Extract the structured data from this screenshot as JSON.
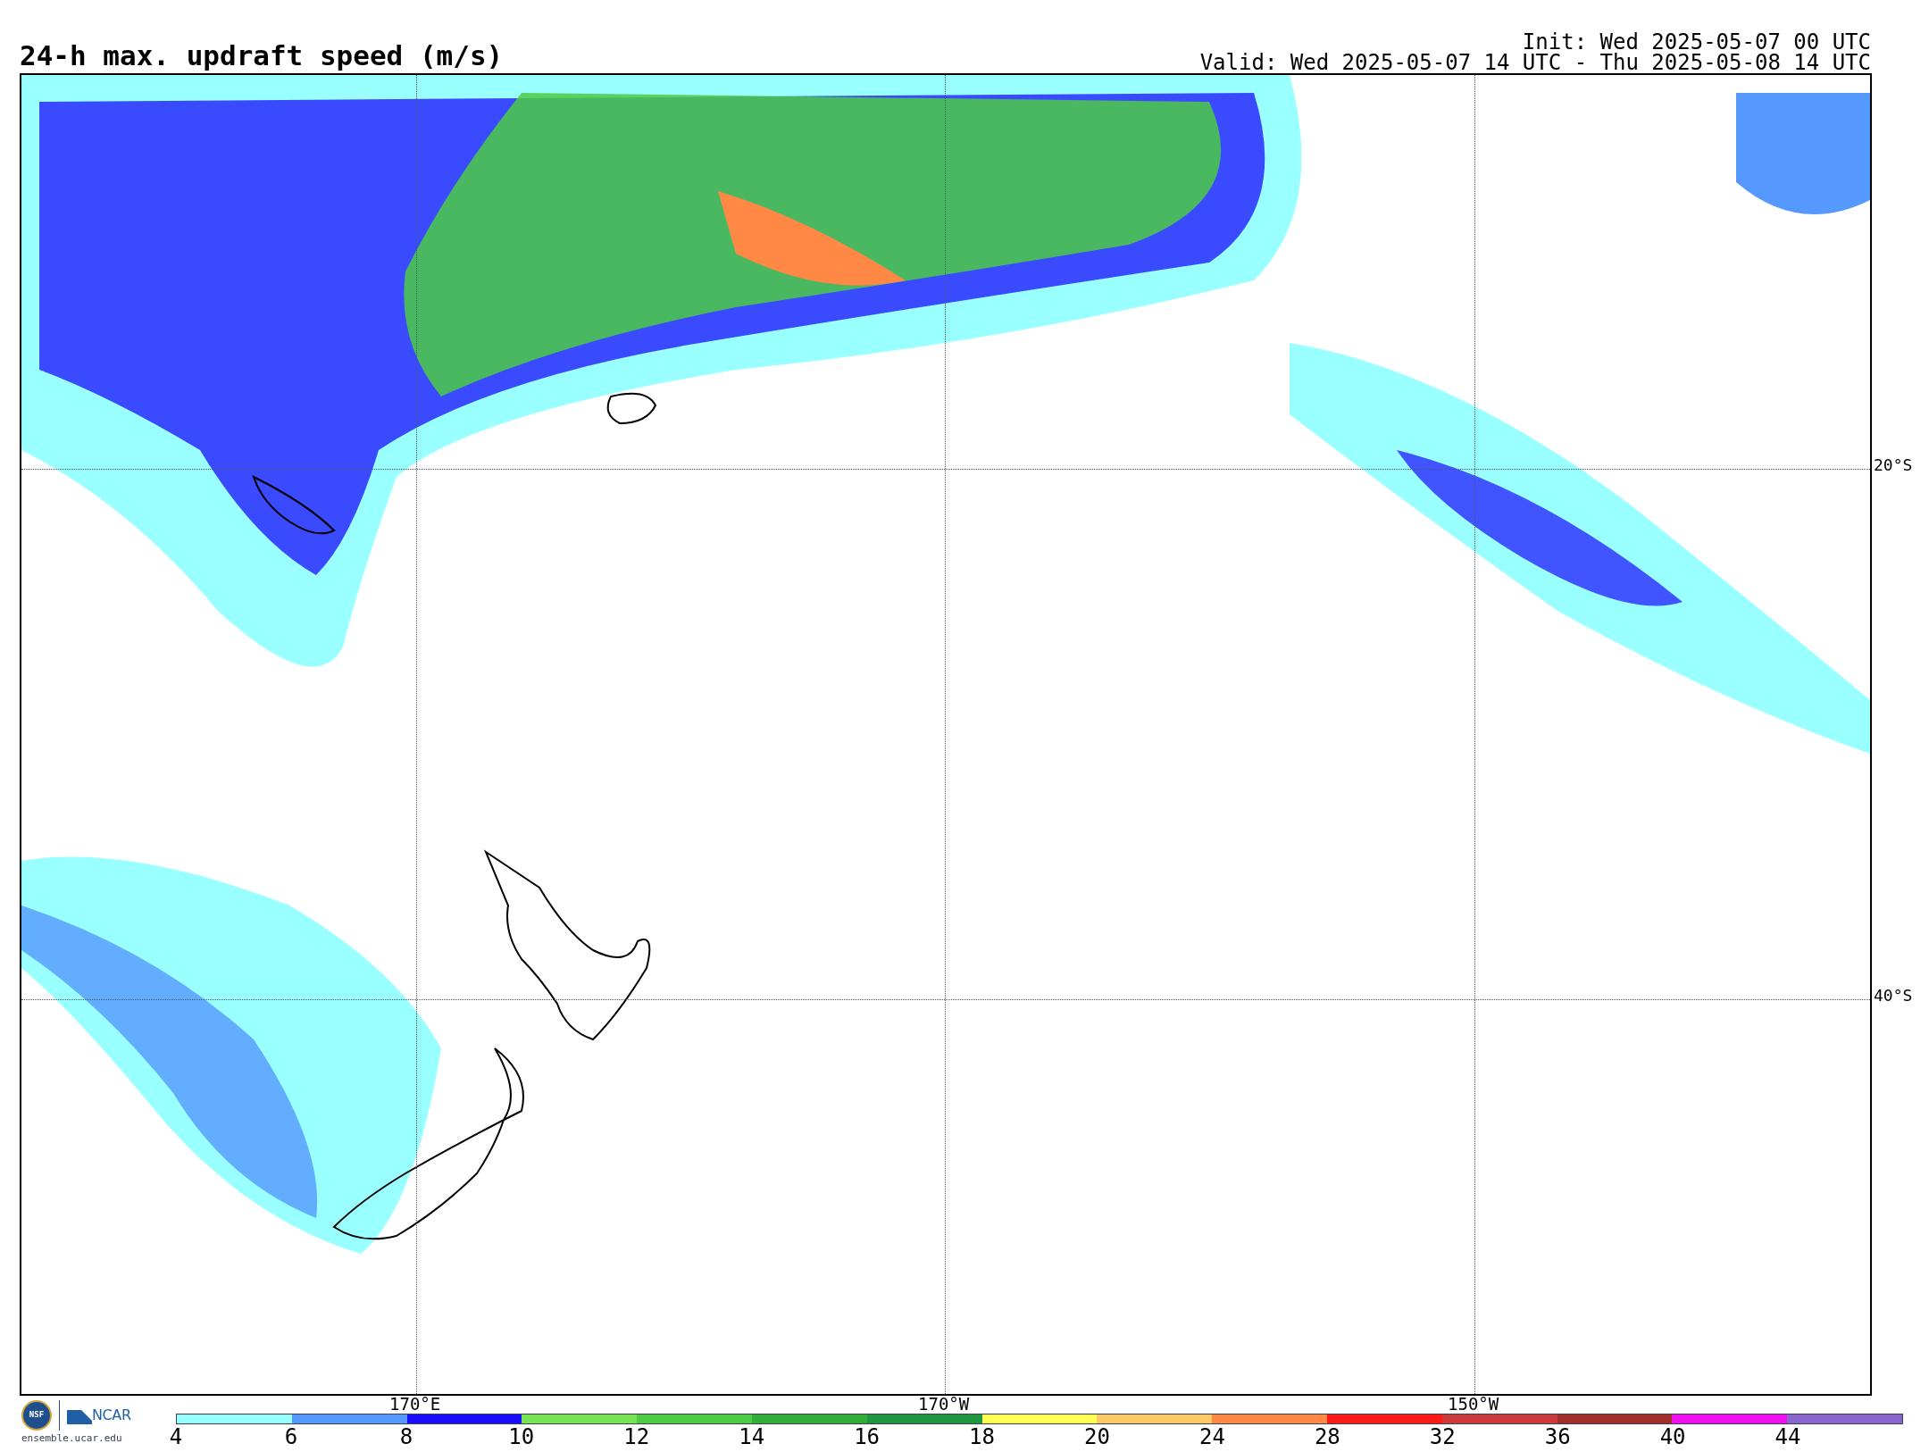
{
  "title": "24-h max. updraft speed (m/s)",
  "init": "Init: Wed 2025-05-07 00 UTC",
  "valid": "Valid: Wed 2025-05-07 14 UTC - Thu 2025-05-08 14 UTC",
  "map": {
    "lat_labels": [
      "20°S",
      "40°S"
    ],
    "lon_labels": [
      "170°E",
      "170°W",
      "150°W"
    ]
  },
  "logos": {
    "seal": "NSF",
    "brand": "NCAR",
    "url": "ensemble.ucar.edu"
  },
  "colorbar": [
    {
      "color": "#99ffff",
      "label": "4"
    },
    {
      "color": "#5599ff",
      "label": "6"
    },
    {
      "color": "#1a0dff",
      "label": "8"
    },
    {
      "color": "#77e355",
      "label": "10"
    },
    {
      "color": "#4ecb44",
      "label": "12"
    },
    {
      "color": "#32ad3a",
      "label": "14"
    },
    {
      "color": "#1f9640",
      "label": "16"
    },
    {
      "color": "#ffff55",
      "label": "18"
    },
    {
      "color": "#ffc966",
      "label": "20"
    },
    {
      "color": "#ff8844",
      "label": "24"
    },
    {
      "color": "#ff1a1a",
      "label": "28"
    },
    {
      "color": "#cc3b3b",
      "label": "32"
    },
    {
      "color": "#a32c2c",
      "label": "36"
    },
    {
      "color": "#ee11ee",
      "label": "40"
    },
    {
      "color": "#8866cc",
      "label": "44"
    }
  ]
}
